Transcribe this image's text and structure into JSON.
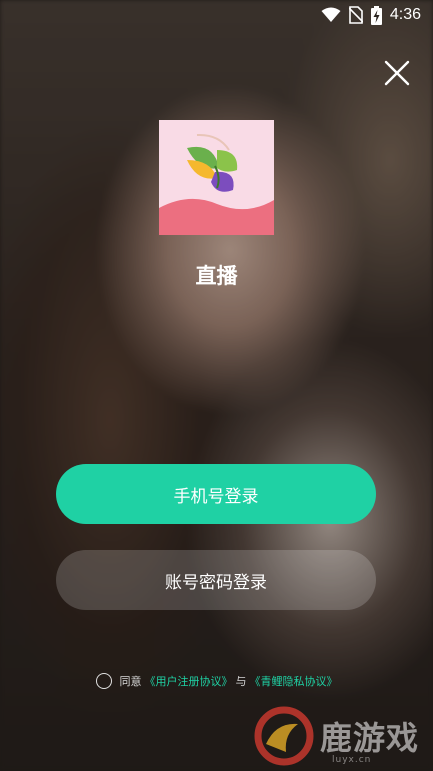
{
  "status_bar": {
    "time": "4:36",
    "icons": [
      "wifi-icon",
      "no-sim-icon",
      "battery-charging-icon"
    ]
  },
  "close_button": {
    "icon": "close-icon"
  },
  "app": {
    "name": "直播",
    "logo": "butterfly-logo"
  },
  "buttons": {
    "phone_login": "手机号登录",
    "account_login": "账号密码登录"
  },
  "agreement": {
    "agree_label": "同意",
    "user_agreement": "《用户注册协议》",
    "connector": "与",
    "privacy_agreement": "《青鲤隐私协议》"
  },
  "colors": {
    "accent": "#1fd1a4",
    "logo_bg": "#f9dbe6",
    "logo_wave": "#ec6f80"
  },
  "watermark": {
    "text": "鹿游戏",
    "url": "luyx.cn"
  }
}
